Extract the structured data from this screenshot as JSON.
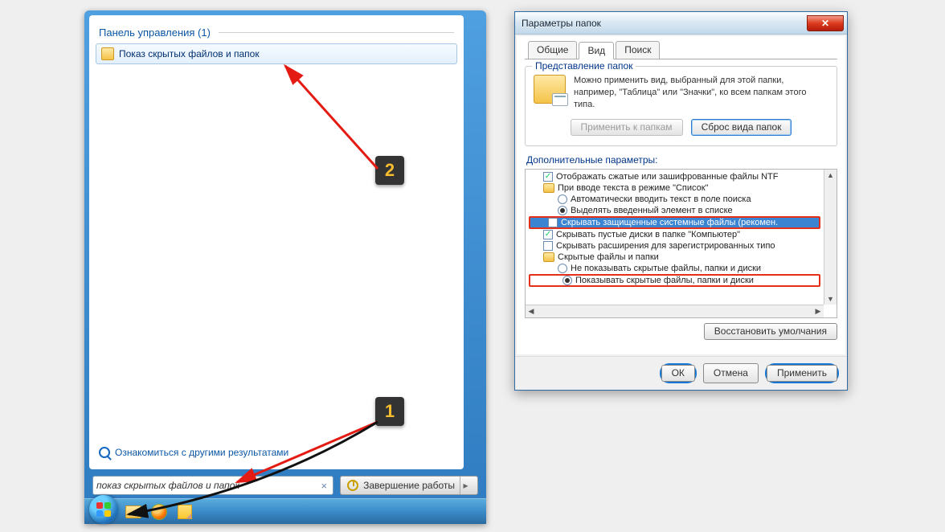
{
  "startmenu": {
    "heading": "Панель управления (1)",
    "result": "Показ скрытых файлов и папок",
    "more_results": "Ознакомиться с другими результатами",
    "search_value": "показ скрытых файлов и папок",
    "shutdown": "Завершение работы"
  },
  "dialog": {
    "title": "Параметры папок",
    "tabs": {
      "general": "Общие",
      "view": "Вид",
      "search": "Поиск"
    },
    "folderviews": {
      "group_title": "Представление папок",
      "desc": "Можно применить вид, выбранный для этой папки, например, \"Таблица\" или \"Значки\", ко всем папкам этого типа.",
      "apply": "Применить к папкам",
      "reset": "Сброс вида папок"
    },
    "adv": {
      "label": "Дополнительные параметры:",
      "items": {
        "ntfs": "Отображать сжатые или зашифрованные файлы NTF",
        "list_mode": "При вводе текста в режиме \"Список\"",
        "auto_search": "Автоматически вводить текст в поле поиска",
        "highlight_item": "Выделять введенный элемент в списке",
        "hide_protected": "Скрывать защищенные системные файлы (рекомен.",
        "hide_empty": "Скрывать пустые диски в папке \"Компьютер\"",
        "hide_ext": "Скрывать расширения для зарегистрированных типо",
        "hidden_group": "Скрытые файлы и папки",
        "dont_show": "Не показывать скрытые файлы, папки и диски",
        "show": "Показывать скрытые файлы, папки и диски"
      }
    },
    "restore": "Восстановить умолчания",
    "ok": "ОК",
    "cancel": "Отмена",
    "apply": "Применить"
  },
  "callouts": {
    "one": "1",
    "two": "2"
  }
}
